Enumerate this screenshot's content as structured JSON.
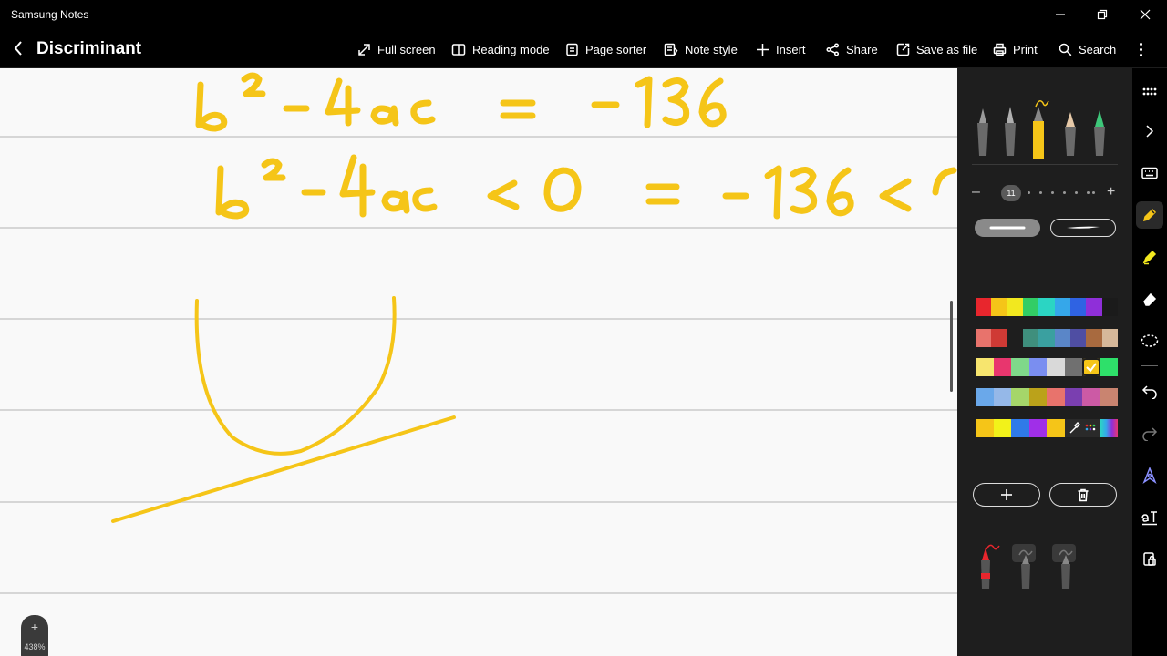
{
  "window": {
    "app_title": "Samsung Notes",
    "minimize_icon": "minimize-icon",
    "restore_icon": "restore-icon",
    "close_icon": "close-icon"
  },
  "toolbar": {
    "note_title": "Discriminant",
    "full_screen": "Full screen",
    "reading_mode": "Reading mode",
    "page_sorter": "Page sorter",
    "note_style": "Note style",
    "insert": "Insert",
    "share": "Share",
    "save_as_file": "Save as file",
    "print": "Print",
    "search": "Search"
  },
  "canvas": {
    "zoom_plus": "+",
    "zoom_level": "438%"
  },
  "pen_panel": {
    "pen_size": "11",
    "ink_color": "#f5c518",
    "selected_pen": "pencil-pen",
    "selected_color": "#f5c518",
    "swatches": [
      [
        "#e8262d",
        "#f5c518",
        "#f2e81f",
        "#32cd65",
        "#2bd5c3",
        "#35a7ea",
        "#2f63e3",
        "#8f2fd9",
        "#1b1b1b"
      ],
      [
        "#e8736c",
        "#cf3a35",
        "#1e1e1e",
        "#3f8f7d",
        "#3aa0a0",
        "#5a86c8",
        "#4f4ea3",
        "#a86a3f",
        "#d6b89a"
      ],
      [
        "#f7e56e",
        "#e8366e",
        "#7fd88a",
        "#7a8ef0",
        "#d9d9d9",
        "#707070",
        "#f5c518",
        "#2ee06a"
      ],
      [
        "#6aa8ea",
        "#95b8e8",
        "#a5d66a",
        "#bba21a",
        "#e8736c",
        "#7a3fb0",
        "#cc5aa5",
        "#c98470"
      ],
      [
        "#f5c518",
        "#f2f21a",
        "#2f7ae8",
        "#a02fe8",
        "#f5c518",
        "eyedropper",
        "palette",
        "spectrum"
      ]
    ]
  },
  "side_strip": {
    "items": [
      "grid-icon",
      "chevron-right-icon",
      "keyboard-icon",
      "pen-icon",
      "highlighter-icon",
      "eraser-icon",
      "lasso-icon",
      "undo-icon",
      "redo-icon",
      "shape-pen-icon",
      "text-recognize-icon",
      "protect-icon"
    ]
  }
}
